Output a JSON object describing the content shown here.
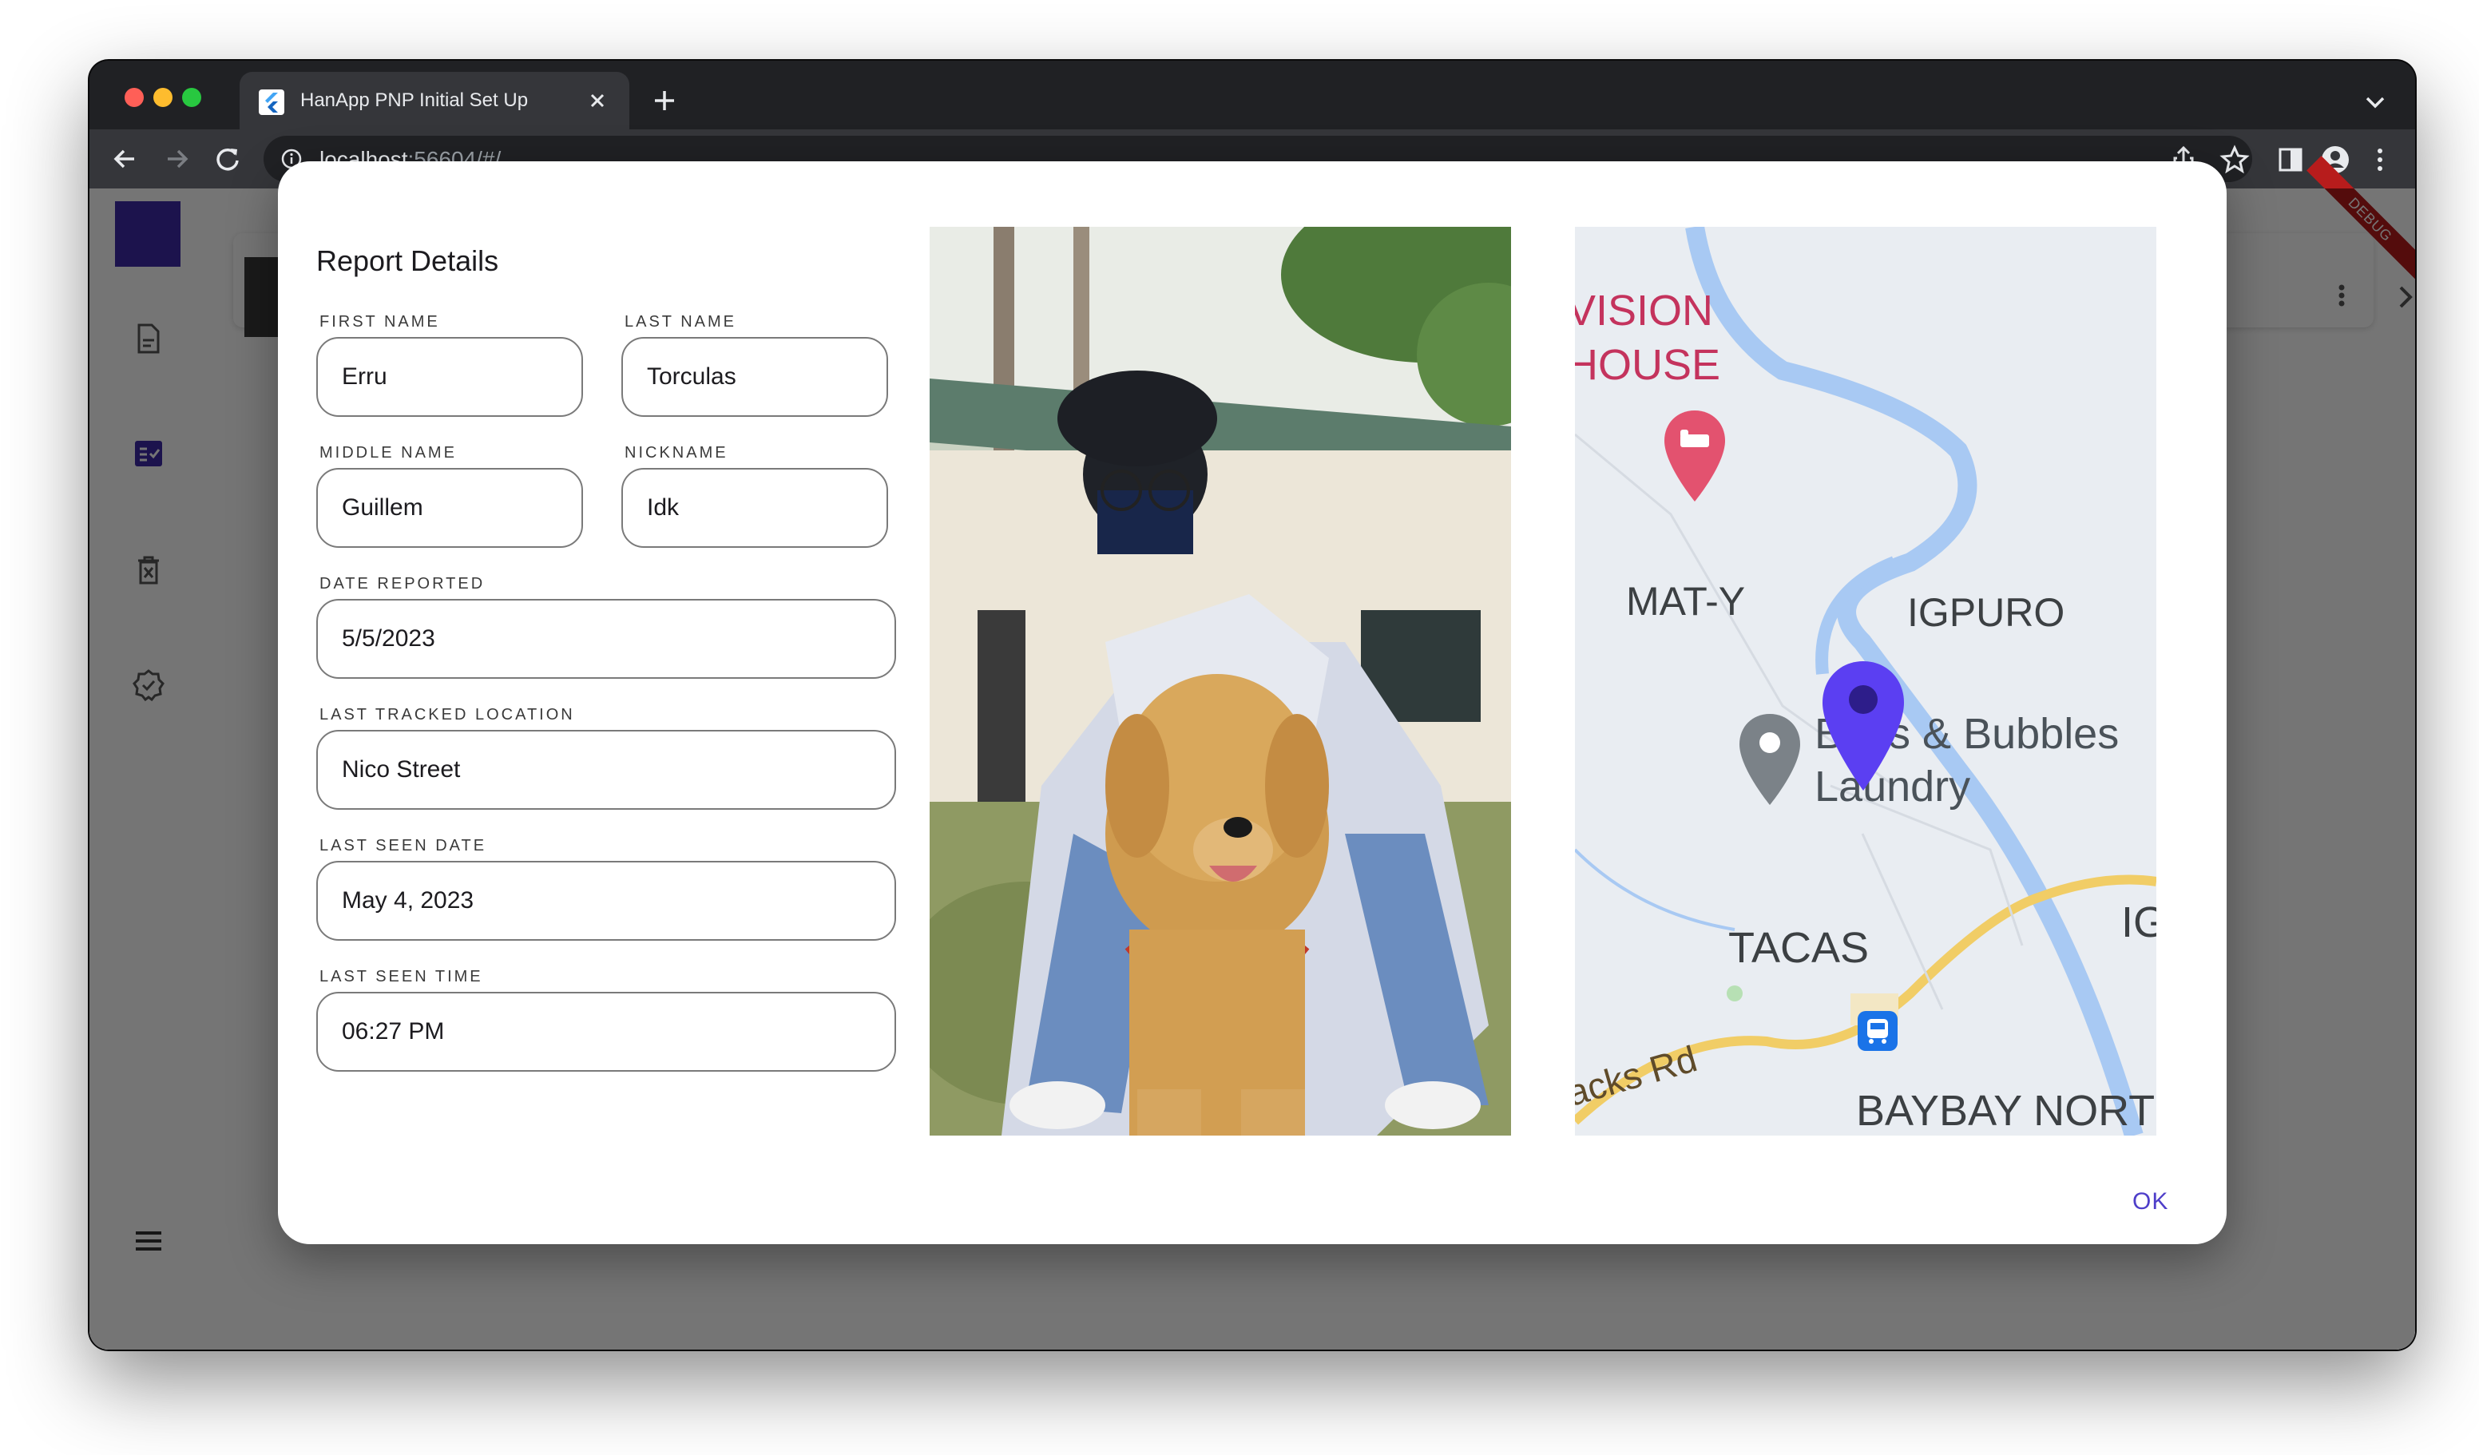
{
  "browser": {
    "tab_title": "HanApp PNP Initial Set Up",
    "url_host": "localhost",
    "url_rest": ":56604/#/"
  },
  "app": {
    "debug_banner": "DEBUG",
    "nav_items": [
      {
        "icon": "document-icon"
      },
      {
        "icon": "checklist-icon"
      },
      {
        "icon": "trash-icon"
      },
      {
        "icon": "verified-badge-icon"
      }
    ]
  },
  "dialog": {
    "title": "Report Details",
    "fields": {
      "first_name": {
        "label": "FIRST NAME",
        "value": "Erru"
      },
      "last_name": {
        "label": "LAST NAME",
        "value": "Torculas"
      },
      "middle_name": {
        "label": "MIDDLE NAME",
        "value": "Guillem"
      },
      "nickname": {
        "label": "NICKNAME",
        "value": "Idk"
      },
      "date_reported": {
        "label": "DATE REPORTED",
        "value": "5/5/2023"
      },
      "last_tracked_location": {
        "label": "LAST TRACKED LOCATION",
        "value": "Nico Street"
      },
      "last_seen_date": {
        "label": "LAST SEEN DATE",
        "value": "May 4, 2023"
      },
      "last_seen_time": {
        "label": "LAST SEEN TIME",
        "value": "06:27 PM"
      }
    },
    "ok_label": "OK",
    "map": {
      "labels": {
        "vision": "VISION",
        "house": "HOUSE",
        "maty": "MAT-Y",
        "igpuro": "IGPURO",
        "bubbles_line1": "Bl  ns & Bubbles",
        "bubbles_line2": "Laundry",
        "tacas": "TACAS",
        "ig": "IG",
        "road": "acks Rd",
        "baybay": "BAYBAY NORTE"
      }
    }
  }
}
